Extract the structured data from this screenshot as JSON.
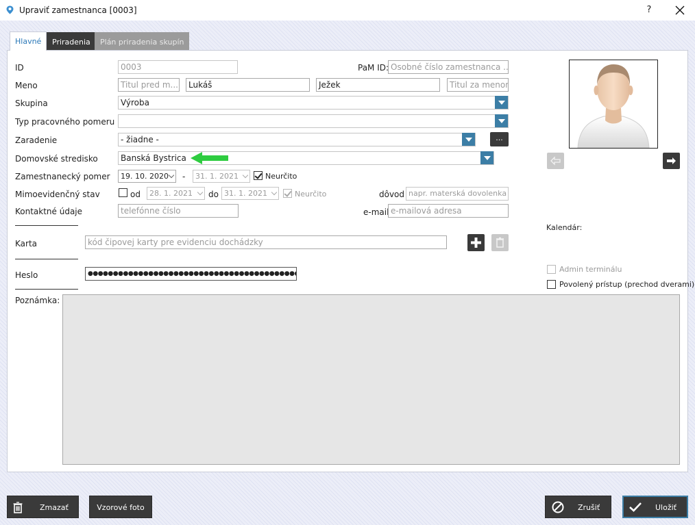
{
  "window": {
    "title": "Upraviť zamestnanca [0003]",
    "help": "?",
    "close": "✕"
  },
  "tabs": {
    "hlavne": "Hlavné",
    "priradenia": "Priradenia",
    "plan": "Plán priradenia skupín"
  },
  "labels": {
    "id": "ID",
    "meno": "Meno",
    "skupina": "Skupina",
    "typ": "Typ pracovného pomeru",
    "zaradenie": "Zaradenie",
    "stredisko": "Domovské stredisko",
    "pomer": "Zamestnanecký pomer",
    "mimo": "Mimoevidenčný stav",
    "kontakt": "Kontaktné údaje",
    "karta": "Karta",
    "heslo": "Heslo",
    "poznamka": "Poznámka:",
    "pam_id": "PaM ID:",
    "od": "od",
    "do": "do",
    "dovod": "dôvod",
    "email": "e-mail",
    "dash": "-",
    "kalendar": "Kalendár:"
  },
  "fields": {
    "id": "0003",
    "pam_placeholder": "Osobné číslo zamestnanca ...",
    "titul_pred_placeholder": "Titul pred m...",
    "meno": "Lukáš",
    "priezvisko": "Ježek",
    "titul_za_placeholder": "Titul za menom",
    "skupina": "Výroba",
    "typ": "",
    "zaradenie": "- žiadne -",
    "zaradenie_more": "...",
    "stredisko": "Banská Bystrica",
    "pomer_od": "19. 10. 2020",
    "pomer_do": "31. 1. 2021",
    "pomer_neurcito": "Neurčito",
    "mimo_od": "28. 1. 2021",
    "mimo_do": "31. 1. 2021",
    "mimo_neurcito": "Neurčito",
    "dovod_placeholder": "napr. materská dovolenka",
    "telefon_placeholder": "telefónne číslo",
    "email_placeholder": "e-mailová adresa",
    "karta_placeholder": "kód čipovej karty pre evidenciu dochádzky",
    "heslo": "●●●●●●●●●●●●●●●●●●●●●●●●●●●●●●●●●●●●●●●●●●●●",
    "poznamka": ""
  },
  "sidebar": {
    "admin_terminal": "Admin terminálu",
    "povoleny_pristup": "Povolený prístup (prechod dverami)"
  },
  "buttons": {
    "zmazat": "Zmazať",
    "vzorove_foto": "Vzorové foto",
    "zrusit": "Zrušiť",
    "ulozit": "Uložiť"
  },
  "colors": {
    "accent": "#3c7ea6",
    "arrow": "#2ecc40",
    "dark_button": "#3a3a3a",
    "save_border": "#3c7ea6"
  },
  "icons": [
    "app-location-icon",
    "arrow-left-icon",
    "arrow-right-icon",
    "plus-icon",
    "trash-icon",
    "cancel-icon",
    "check-icon"
  ]
}
